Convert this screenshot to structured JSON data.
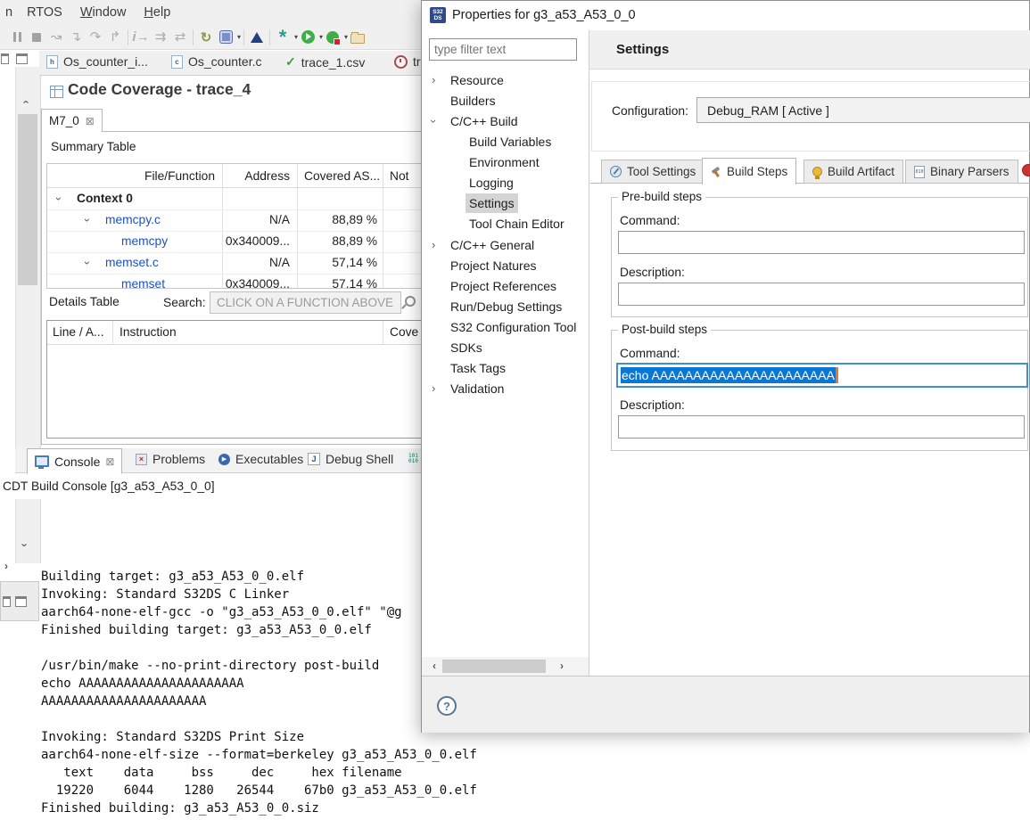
{
  "glyphs": {
    "chevron": "›",
    "close": "⊠",
    "dropdown": "▾",
    "help": "?",
    "check": "✓",
    "scroll_left": "‹",
    "scroll_right": "›",
    "note": "↝",
    "step_into": "↴",
    "step_over": "↷",
    "step_return": "↱",
    "step_i": "i",
    "arrow_right": "→",
    "step_all": "⇉",
    "swap": "⇄",
    "reset": "↻",
    "cross": "×",
    "play": "▶",
    "shell": "J",
    "file_h": "h",
    "file_c": "c",
    "mem_top": "101",
    "mem_bottom": "010",
    "binary": "010",
    "s32_line1": "S32",
    "s32_line2": "DS"
  },
  "menu_bar": {
    "items": [
      "n",
      "RTOS",
      "Window",
      "Help"
    ]
  },
  "editor_tabs": [
    {
      "label": "Os_counter_i..."
    },
    {
      "label": "Os_counter.c"
    },
    {
      "label": "trace_1.csv"
    },
    {
      "label": "tr"
    }
  ],
  "coverage_view": {
    "title": "Code Coverage - trace_4",
    "tab_label": "M7_0",
    "summary": {
      "label": "Summary Table",
      "columns": [
        "File/Function",
        "Address",
        "Covered AS...",
        "Not"
      ],
      "rows": [
        {
          "file": "Context 0",
          "address": "",
          "covered": ""
        },
        {
          "file": "memcpy.c",
          "address": "N/A",
          "covered": "88,89 %"
        },
        {
          "file": "memcpy",
          "address": "0x340009...",
          "covered": "88,89 %"
        },
        {
          "file": "memset.c",
          "address": "N/A",
          "covered": "57,14 %"
        },
        {
          "file": "memset",
          "address": "0x340009...",
          "covered": "57,14 %"
        }
      ]
    },
    "details": {
      "label": "Details Table",
      "search_label": "Search:",
      "search_value": "CLICK ON A FUNCTION ABOVE",
      "columns": [
        "Line / A...",
        "Instruction",
        "Cove"
      ]
    }
  },
  "console_view": {
    "tabs": [
      "Console",
      "Problems",
      "Executables",
      "Debug Shell"
    ],
    "subtitle": "CDT Build Console [g3_a53_A53_0_0]",
    "lines": [
      "Building target: g3_a53_A53_0_0.elf",
      "Invoking: Standard S32DS C Linker",
      "aarch64-none-elf-gcc -o \"g3_a53_A53_0_0.elf\" \"@g",
      "Finished building target: g3_a53_A53_0_0.elf",
      "",
      "/usr/bin/make --no-print-directory post-build",
      "echo AAAAAAAAAAAAAAAAAAAAAA",
      "AAAAAAAAAAAAAAAAAAAAAA",
      "",
      "Invoking: Standard S32DS Print Size",
      "aarch64-none-elf-size --format=berkeley g3_a53_A53_0_0.elf",
      "   text    data     bss     dec     hex filename",
      "  19220    6044    1280   26544    67b0 g3_a53_A53_0_0.elf",
      "Finished building: g3_a53_A53_0_0.siz"
    ]
  },
  "dialog": {
    "title": "Properties for g3_a53_A53_0_0",
    "filter_placeholder": "type filter text",
    "tree": [
      {
        "label": "Resource"
      },
      {
        "label": "Builders"
      },
      {
        "label": "C/C++ Build"
      },
      {
        "label": "Build Variables"
      },
      {
        "label": "Environment"
      },
      {
        "label": "Logging"
      },
      {
        "label": "Settings"
      },
      {
        "label": "Tool Chain Editor"
      },
      {
        "label": "C/C++ General"
      },
      {
        "label": "Project Natures"
      },
      {
        "label": "Project References"
      },
      {
        "label": "Run/Debug Settings"
      },
      {
        "label": "S32 Configuration Tool"
      },
      {
        "label": "SDKs"
      },
      {
        "label": "Task Tags"
      },
      {
        "label": "Validation"
      }
    ],
    "page_title": "Settings",
    "configuration_label": "Configuration:",
    "configuration_value": "Debug_RAM  [ Active ]",
    "tabs": [
      "Tool Settings",
      "Build Steps",
      "Build Artifact",
      "Binary Parsers"
    ],
    "pre_build": {
      "legend": "Pre-build steps",
      "command_label": "Command:",
      "command_value": "",
      "description_label": "Description:",
      "description_value": ""
    },
    "post_build": {
      "legend": "Post-build steps",
      "command_label": "Command:",
      "command_value": "echo AAAAAAAAAAAAAAAAAAAAAA",
      "description_label": "Description:",
      "description_value": ""
    }
  }
}
